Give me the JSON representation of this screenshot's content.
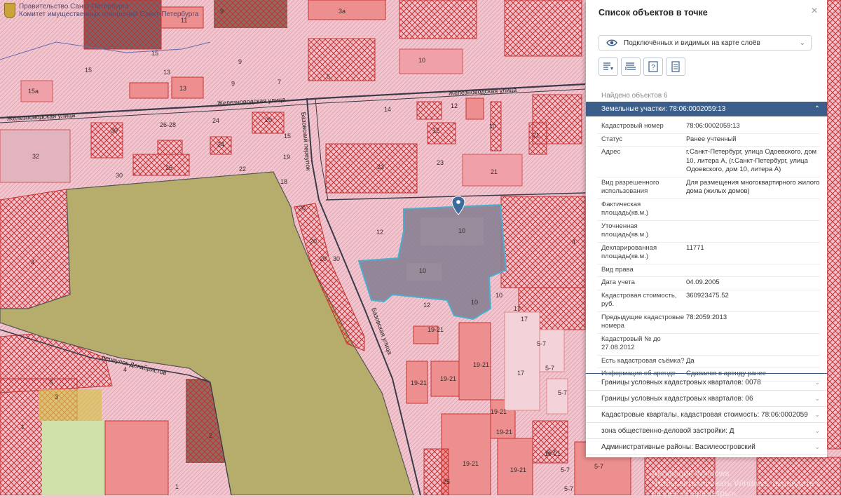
{
  "header": {
    "line1": "Правительство Санкт-Петербурга",
    "line2": "Комитет имущественных отношений Санкт-Петербурга"
  },
  "map": {
    "streets": [
      "Железноводская улица",
      "Железноводская улица",
      "Железноводская улица",
      "Базовский переулок",
      "Базовская улица",
      "переулок Декабристов"
    ],
    "labels": [
      "9",
      "3а",
      "11",
      "15",
      "15",
      "13",
      "13",
      "15а",
      "9",
      "7",
      "5",
      "10",
      "9",
      "14",
      "12",
      "24",
      "20",
      "15",
      "12",
      "10",
      "30",
      "26-28",
      "24",
      "26",
      "22",
      "18",
      "23",
      "23",
      "21",
      "21",
      "32",
      "30",
      "19",
      "12",
      "10",
      "10",
      "10",
      "4",
      "12",
      "20",
      "20",
      "20",
      "30",
      "4",
      "10",
      "17",
      "17",
      "19-21",
      "19-21",
      "19-21",
      "19-21",
      "19-21",
      "19-21",
      "19-21",
      "17",
      "5-7",
      "5-7",
      "5-7",
      "5-7",
      "5-7",
      "5-7",
      "5-7",
      "4",
      "1",
      "3",
      "5",
      "2",
      "1",
      "25",
      "19-21",
      "19-21"
    ]
  },
  "panel": {
    "title": "Список объектов в точке",
    "close_label": "×",
    "layer_select": "Подключённых и видимых на карте слоёв",
    "found_text": "Найдено объектов 6",
    "active_section": "Земельные участки: 78:06:0002059:13",
    "attributes": [
      {
        "key": "Кадастровый номер",
        "value": "78:06:0002059:13"
      },
      {
        "key": "Статус",
        "value": "Ранее учтенный"
      },
      {
        "key": "Адрес",
        "value": "г.Санкт-Петербург, улица Одоевского, дом 10, литера А, (г.Санкт-Петербург, улица Одоевского, дом 10, литера А)"
      },
      {
        "key": "Вид разрешенного использования",
        "value": "Для размещения многоквартирного жилого дома (жилых домов)"
      },
      {
        "key": "Фактическая площадь(кв.м.)",
        "value": ""
      },
      {
        "key": "Уточненная площадь(кв.м.)",
        "value": ""
      },
      {
        "key": "Декларированная площадь(кв.м.)",
        "value": "11771"
      },
      {
        "key": "Вид права",
        "value": ""
      },
      {
        "key": "Дата учета",
        "value": "04.09.2005"
      },
      {
        "key": "Кадастровая стоимость, руб.",
        "value": "360923475.52"
      },
      {
        "key": "Предыдущие кадастровые номера",
        "value": "78:2059:2013"
      },
      {
        "key": "Кадастровый № до 27.08.2012",
        "value": ""
      },
      {
        "key": "Есть кадастровая съёмка?",
        "value": "Да"
      },
      {
        "key": "Информация об аренде",
        "value": "Сдавался в аренду ранее"
      }
    ],
    "sections": [
      "Границы условных кадастровых кварталов: 0078",
      "Границы условных кадастровых кварталов: 06",
      "Кадастровые кварталы, кадастровая стоимость: 78:06:0002059",
      "зона общественно-деловой застройки: Д",
      "Административные районы: Василеостровский"
    ]
  },
  "watermark": {
    "line1": "Активация Windows",
    "line2": "Чтобы активировать Windows, перейдите в раздел «Параметры»."
  },
  "colors": {
    "accent": "#3b5f8a",
    "map_background": "#f3c6cf",
    "hatch_red": "#d23a3a",
    "park_green": "#b6ad6c",
    "selected_parcel": "#8a7f93"
  }
}
